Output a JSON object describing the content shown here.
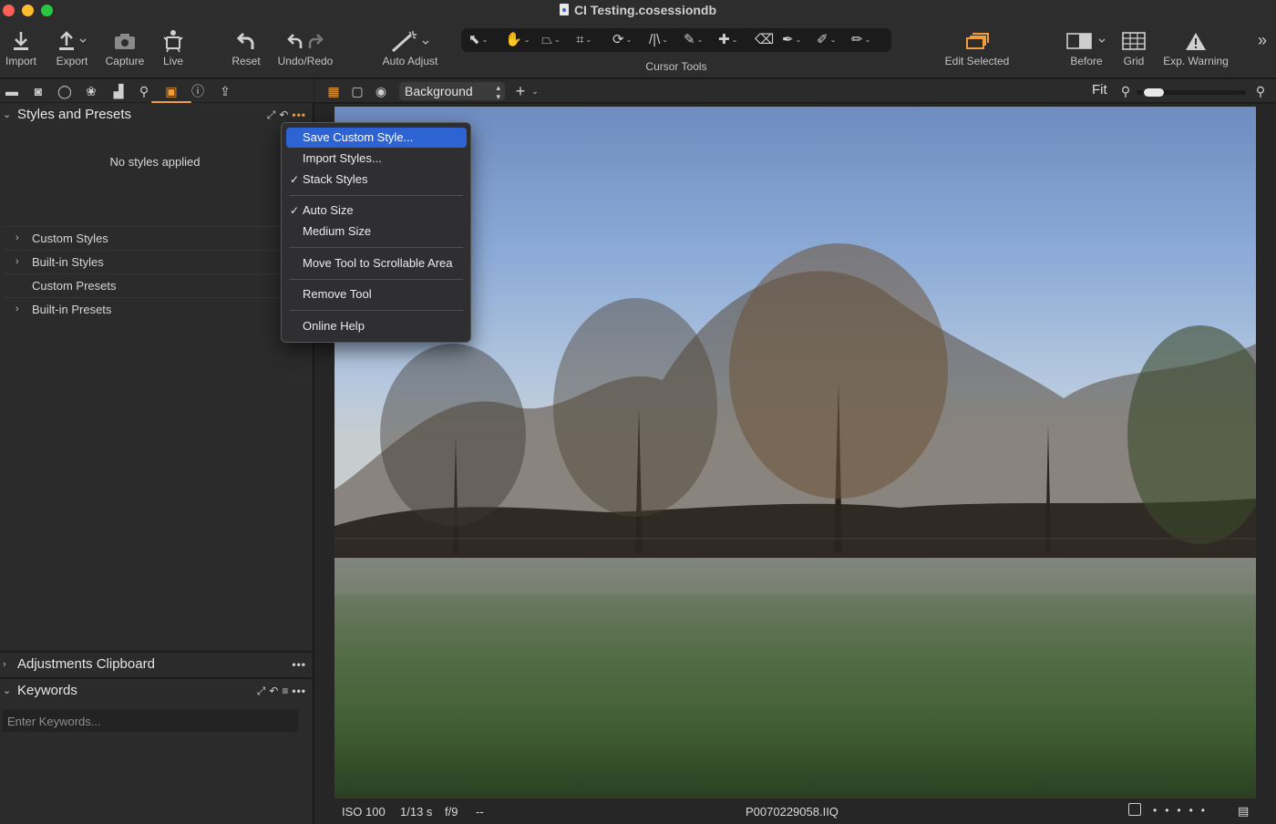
{
  "window": {
    "title": "CI Testing.cosessiondb"
  },
  "toolbar": {
    "import": "Import",
    "export": "Export",
    "capture": "Capture",
    "live": "Live",
    "reset": "Reset",
    "undo_redo": "Undo/Redo",
    "auto_adjust": "Auto Adjust",
    "cursor_tools": "Cursor Tools",
    "edit_selected": "Edit Selected",
    "before": "Before",
    "grid": "Grid",
    "exp_warning": "Exp. Warning"
  },
  "styles_panel": {
    "title": "Styles and Presets",
    "empty_message": "No styles applied",
    "items": [
      {
        "label": "Custom Styles",
        "expandable": true
      },
      {
        "label": "Built-in Styles",
        "expandable": true
      },
      {
        "label": "Custom Presets",
        "expandable": false
      },
      {
        "label": "Built-in Presets",
        "expandable": true
      }
    ]
  },
  "clipboard_panel": {
    "title": "Adjustments Clipboard"
  },
  "keywords_panel": {
    "title": "Keywords",
    "input_placeholder": "Enter Keywords..."
  },
  "viewer_bar": {
    "variant": "Background",
    "fit_label": "Fit",
    "zoom_level": 0.08
  },
  "context_menu": {
    "items": [
      {
        "label": "Save Custom Style...",
        "checked": false,
        "highlighted": true
      },
      {
        "label": "Import Styles...",
        "checked": false
      },
      {
        "label": "Stack Styles",
        "checked": true
      },
      {
        "label": "Auto Size",
        "checked": true
      },
      {
        "label": "Medium Size",
        "checked": false
      },
      {
        "label": "Move Tool to Scrollable Area",
        "checked": false
      },
      {
        "label": "Remove Tool",
        "checked": false
      },
      {
        "label": "Online Help",
        "checked": false
      }
    ]
  },
  "info_bar": {
    "iso": "ISO 100",
    "shutter": "1/13 s",
    "aperture": "f/9",
    "extra": "--",
    "filename": "P0070229058.IIQ"
  },
  "colors": {
    "accent": "#f29d39",
    "menu_highlight": "#2e63d4",
    "panel_bg": "#2b2b2b",
    "toolbar_bg": "#2d2d2d"
  },
  "icons": {
    "menu_check": "✓"
  }
}
